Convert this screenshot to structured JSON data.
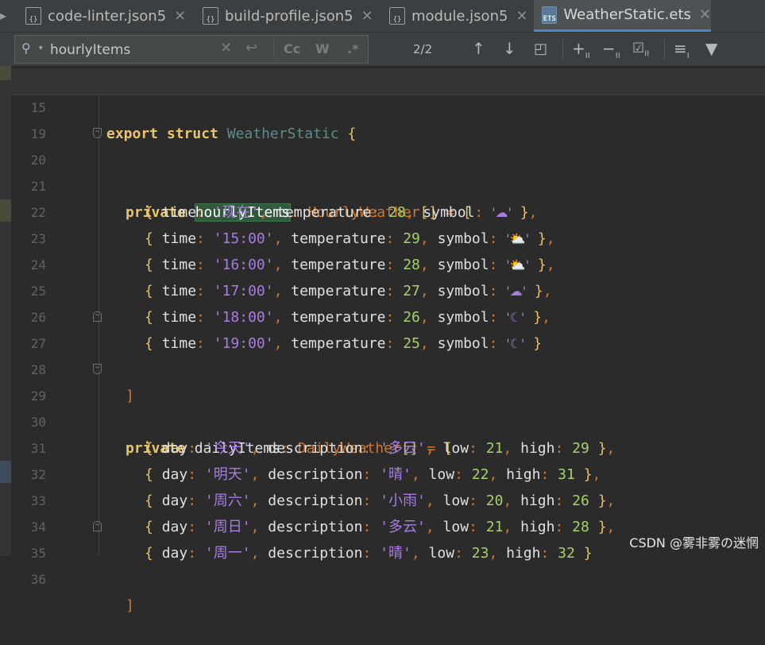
{
  "tabs": [
    {
      "label": "code-linter.json5",
      "icon": "json-file-icon"
    },
    {
      "label": "build-profile.json5",
      "icon": "json-file-icon"
    },
    {
      "label": "module.json5",
      "icon": "json-file-icon"
    },
    {
      "label": "WeatherStatic.ets",
      "icon": "ets-file-icon",
      "active": true
    }
  ],
  "search": {
    "value": "hourlyItems",
    "case_label": "Cc",
    "word_label": "W",
    "regex_label": ".*",
    "match_count": "2/2"
  },
  "lines": [
    {
      "n": "15",
      "id": "line-15"
    },
    {
      "n": "19",
      "id": "line-19"
    },
    {
      "n": "20",
      "id": "line-20"
    },
    {
      "n": "21",
      "id": "line-21",
      "time": "'现在'",
      "temp": "28",
      "sym": "'☁'"
    },
    {
      "n": "22",
      "id": "line-22",
      "time": "'15:00'",
      "temp": "29",
      "sym": "'⛅'"
    },
    {
      "n": "23",
      "id": "line-23",
      "time": "'16:00'",
      "temp": "28",
      "sym": "'⛅'"
    },
    {
      "n": "24",
      "id": "line-24",
      "time": "'17:00'",
      "temp": "27",
      "sym": "'☁'"
    },
    {
      "n": "25",
      "id": "line-25",
      "time": "'18:00'",
      "temp": "26",
      "sym": "'☾'"
    },
    {
      "n": "26",
      "id": "line-26",
      "time": "'19:00'",
      "temp": "25",
      "sym": "'☾'"
    },
    {
      "n": "27",
      "id": "line-27"
    },
    {
      "n": "28",
      "id": "line-28"
    },
    {
      "n": "29",
      "id": "line-29"
    },
    {
      "n": "30",
      "id": "line-30",
      "day": "'今天'",
      "desc": "'多云'",
      "low": "21",
      "high": "29"
    },
    {
      "n": "31",
      "id": "line-31",
      "day": "'明天'",
      "desc": "'晴'",
      "low": "22",
      "high": "31"
    },
    {
      "n": "32",
      "id": "line-32",
      "day": "'周六'",
      "desc": "'小雨'",
      "low": "20",
      "high": "26"
    },
    {
      "n": "33",
      "id": "line-33",
      "day": "'周日'",
      "desc": "'多云'",
      "low": "21",
      "high": "28"
    },
    {
      "n": "34",
      "id": "line-34",
      "day": "'周一'",
      "desc": "'晴'",
      "low": "23",
      "high": "32"
    },
    {
      "n": "35",
      "id": "line-35"
    },
    {
      "n": "36",
      "id": "line-36"
    }
  ],
  "code": {
    "export_kw": "export",
    "struct_kw": "struct",
    "struct_name": "WeatherStatic",
    "private_kw": "private",
    "hourly_name": "hourlyItems",
    "hourly_type": "HourlyWeather",
    "daily_name": "dailyItems",
    "daily_type": "DailyWeather",
    "k_time": "time",
    "k_temp": "temperature",
    "k_symbol": "symbol",
    "k_day": "day",
    "k_desc": "description",
    "k_low": "low",
    "k_high": "high"
  },
  "watermark": "CSDN @雾非雾の迷惘"
}
